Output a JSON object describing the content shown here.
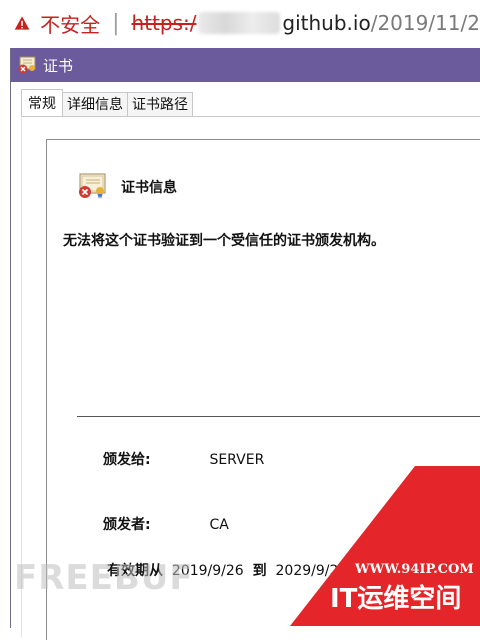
{
  "address_bar": {
    "security_label": "不安全",
    "separator": "|",
    "scheme": "https:/",
    "host": "github.io",
    "path": "/2019/11/2"
  },
  "dialog": {
    "title": "证书",
    "tabs": [
      "常规",
      "详细信息",
      "证书路径"
    ],
    "active_tab": "常规",
    "info_title": "证书信息",
    "message": "无法将这个证书验证到一个受信任的证书颁发机构。",
    "issued_to_label": "颁发给:",
    "issued_to_value": "SERVER",
    "issued_by_label": "颁发者:",
    "issued_by_value": "CA",
    "validity_label": "有效期从",
    "valid_from": "2019/9/26",
    "to_label": "到",
    "valid_to": "2029/9/2"
  },
  "watermarks": {
    "left": "FREEBUF",
    "right_url": "WWW.94IP.COM",
    "right_brand": "IT运维空间"
  },
  "colors": {
    "titlebar": "#6b5a9c",
    "insecure_red": "#c5221f",
    "watermark_red": "#e4262a"
  },
  "icons": [
    "warning-triangle-icon",
    "certificate-icon",
    "certificate-error-icon"
  ]
}
